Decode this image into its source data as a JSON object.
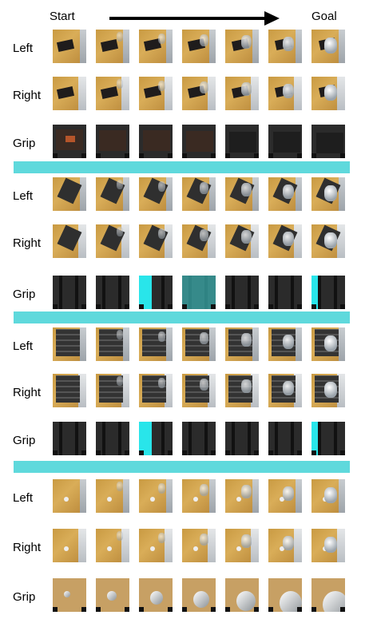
{
  "header": {
    "start_label": "Start",
    "goal_label": "Goal"
  },
  "blocks": [
    {
      "name": "block-1",
      "object": "box",
      "rows": [
        {
          "label": "Left",
          "view": "left"
        },
        {
          "label": "Right",
          "view": "right"
        },
        {
          "label": "Grip",
          "view": "grip"
        }
      ]
    },
    {
      "name": "block-2",
      "object": "drawer",
      "rows": [
        {
          "label": "Left",
          "view": "left"
        },
        {
          "label": "Right",
          "view": "right"
        },
        {
          "label": "Grip",
          "view": "grip"
        }
      ]
    },
    {
      "name": "block-3",
      "object": "grid-tray",
      "rows": [
        {
          "label": "Left",
          "view": "left"
        },
        {
          "label": "Right",
          "view": "right"
        },
        {
          "label": "Grip",
          "view": "grip"
        }
      ]
    },
    {
      "name": "block-4",
      "object": "small-item",
      "rows": [
        {
          "label": "Left",
          "view": "left"
        },
        {
          "label": "Right",
          "view": "right"
        },
        {
          "label": "Grip",
          "view": "grip"
        }
      ]
    }
  ],
  "frames_per_row": 7,
  "colors": {
    "separator": "#5fd9dc",
    "wood": "#c99a42",
    "arrow": "#000000"
  }
}
